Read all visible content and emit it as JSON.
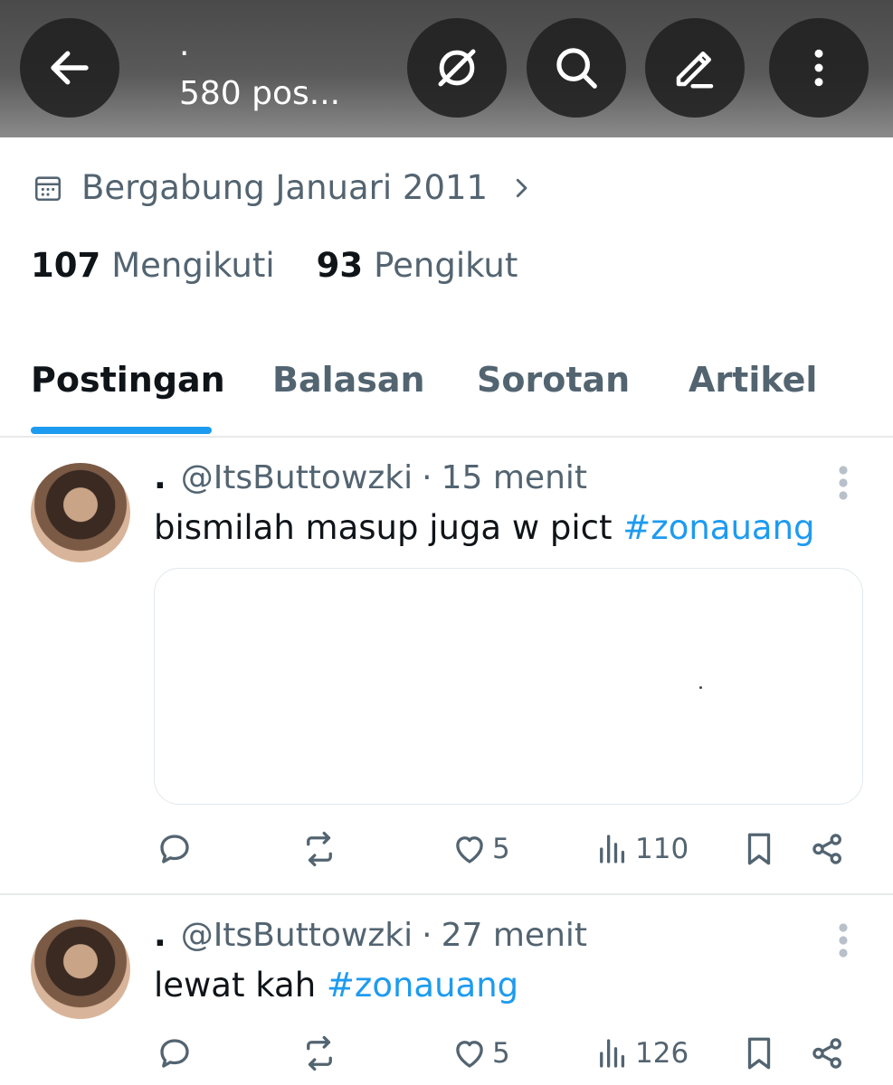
{
  "header": {
    "name": "·",
    "post_count": "580 pos..."
  },
  "profile": {
    "joined": "Bergabung Januari 2011",
    "following_count": "107",
    "following_label": "Mengikuti",
    "followers_count": "93",
    "followers_label": "Pengikut"
  },
  "tabs": [
    {
      "label": "Postingan",
      "active": true
    },
    {
      "label": "Balasan",
      "active": false
    },
    {
      "label": "Sorotan",
      "active": false
    },
    {
      "label": "Artikel",
      "active": false
    }
  ],
  "posts": [
    {
      "name": ".",
      "handle": "@ItsButtowzki",
      "sep": "·",
      "time": "15 menit",
      "text": "bismilah masup juga w pict ",
      "hashtag": "#zonauang",
      "likes": "5",
      "views": "110"
    },
    {
      "name": ".",
      "handle": "@ItsButtowzki",
      "sep": "·",
      "time": "27 menit",
      "text": "lewat kah ",
      "hashtag": "#zonauang",
      "likes": "5",
      "views": "126"
    }
  ],
  "colors": {
    "accent": "#1d9bf0",
    "secondary_text": "#536471",
    "primary_text": "#0f1419"
  }
}
